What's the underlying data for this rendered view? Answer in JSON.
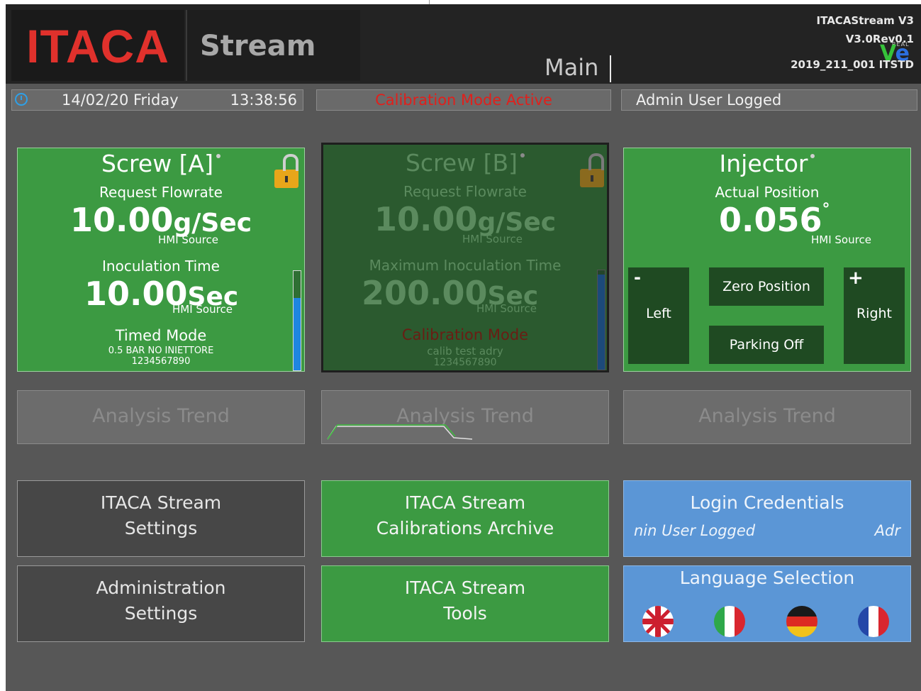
{
  "header": {
    "logo": "ITACA",
    "app_label": "Stream",
    "screen_title": "Main",
    "version_line1": "ITACAStream V3",
    "version_line2": "V3.0Rev0.1",
    "version_line3": "2019_211_001 ITSTD",
    "vendor_sub": "REAL"
  },
  "status": {
    "date": "14/02/20 Friday",
    "time": "13:38:56",
    "mode_message": "Calibration Mode Active",
    "user_message": "Admin User Logged",
    "mode_color": "#e0201c"
  },
  "screw_a": {
    "title": "Screw [A]",
    "flow_label": "Request Flowrate",
    "flow_value": "10.00",
    "flow_unit": "g/Sec",
    "flow_source": "HMI Source",
    "time_label": "Inoculation Time",
    "time_value": "10.00",
    "time_unit": "Sec",
    "time_source": "HMI Source",
    "mode": "Timed Mode",
    "recipe": "0.5 BAR NO INIETTORE",
    "code": "1234567890",
    "bar_fill": 0.73
  },
  "screw_b": {
    "title": "Screw [B]",
    "flow_label": "Request Flowrate",
    "flow_value": "10.00",
    "flow_unit": "g/Sec",
    "flow_source": "HMI Source",
    "time_label": "Maximum Inoculation Time",
    "time_value": "200.00",
    "time_unit": "Sec",
    "time_source": "HMI Source",
    "mode": "Calibration Mode",
    "recipe": "calib test adry",
    "code": "1234567890",
    "bar_fill": 0.96
  },
  "injector": {
    "title": "Injector",
    "position_label": "Actual Position",
    "position_value": "0.056",
    "position_unit": "°",
    "source": "HMI Source",
    "left_sign": "-",
    "left_label": "Left",
    "right_sign": "+",
    "right_label": "Right",
    "zero_label": "Zero Position",
    "parking_label": "Parking Off"
  },
  "trends": [
    {
      "label": "Analysis Trend"
    },
    {
      "label": "Analysis Trend"
    },
    {
      "label": "Analysis Trend"
    }
  ],
  "menu": {
    "stream_settings": {
      "line1": "ITACA Stream",
      "line2": "Settings"
    },
    "calibrations_archive": {
      "line1": "ITACA Stream",
      "line2": "Calibrations Archive"
    },
    "login": {
      "title": "Login Credentials",
      "user_scroll_a": "nin User Logged",
      "user_scroll_b": "Adr"
    },
    "admin_settings": {
      "line1": "Administration",
      "line2": "Settings"
    },
    "tools": {
      "line1": "ITACA Stream",
      "line2": "Tools"
    },
    "language": {
      "title": "Language Selection"
    }
  },
  "languages": [
    {
      "name": "english-flag-icon"
    },
    {
      "name": "italian-flag-icon"
    },
    {
      "name": "german-flag-icon"
    },
    {
      "name": "french-flag-icon"
    }
  ],
  "colors": {
    "card_green": "#3c9a42",
    "card_disabled": "#2b5a2f",
    "brand_red": "#e0312c",
    "login_blue": "#5b96d6"
  }
}
